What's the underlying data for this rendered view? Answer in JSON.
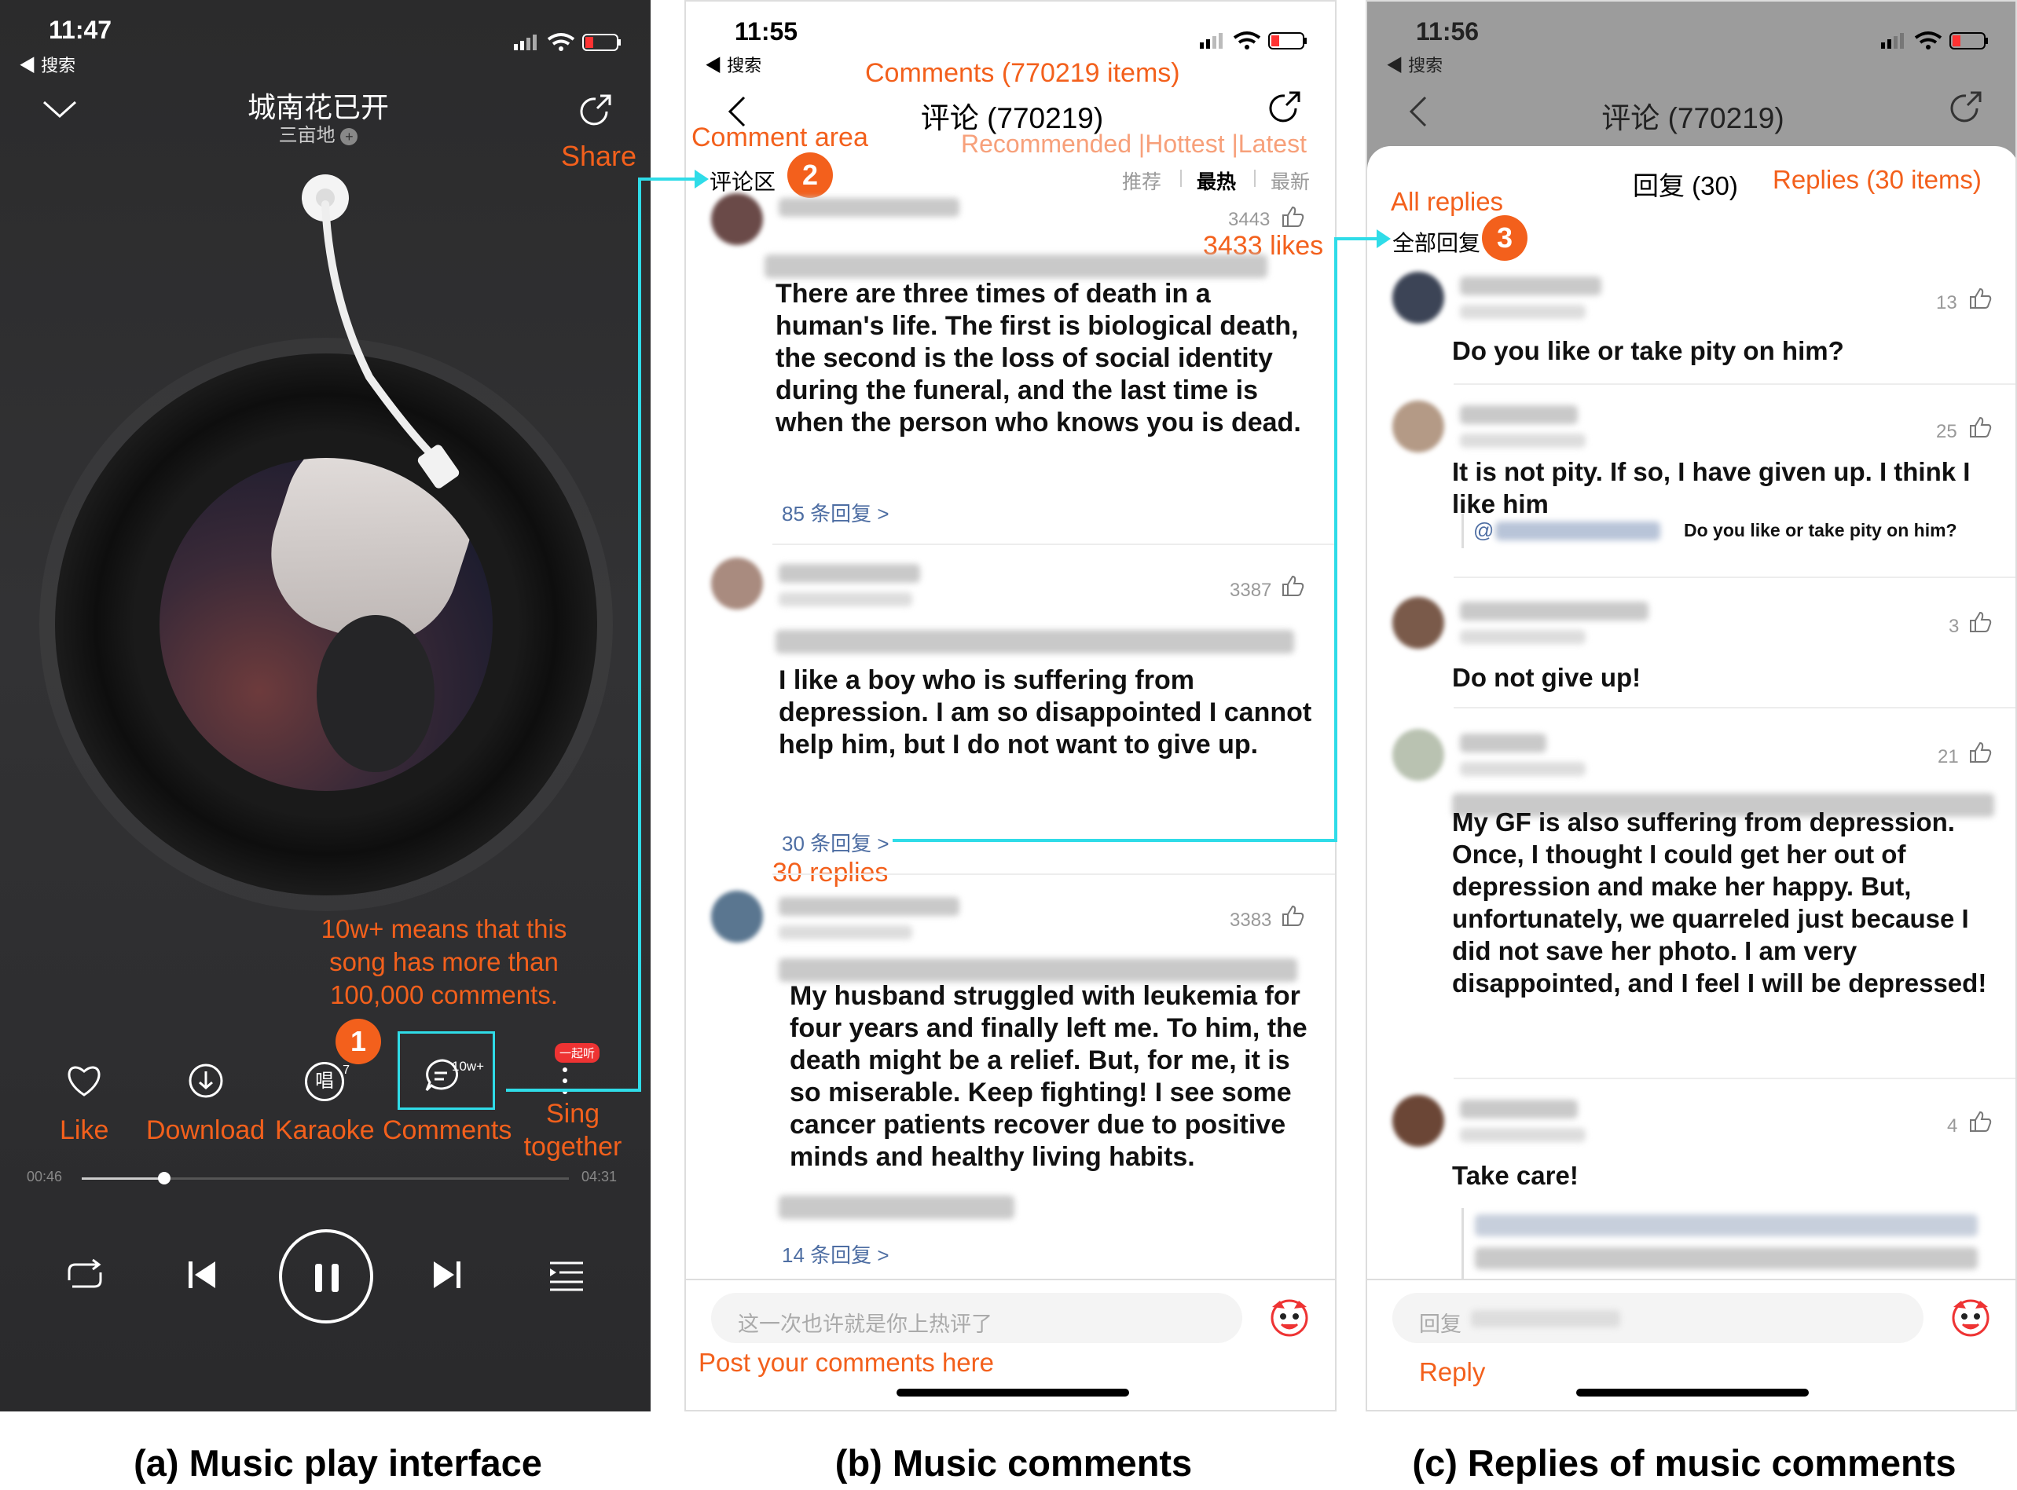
{
  "panel_a": {
    "time": "11:47",
    "back_app": "◀ 搜索",
    "song_title": "城南花已开",
    "artist": "三亩地",
    "share_label": "Share",
    "annotation_comments": "10w+ means that this song has more than 100,000 comments.",
    "comment_count_badge": "10w+",
    "sing_badge": "一起听",
    "karaoke_glyph": "唱",
    "karaoke_badge_num": "7",
    "controls": {
      "like": "Like",
      "download": "Download",
      "karaoke": "Karaoke",
      "comments": "Comments",
      "sing_together": "Sing together"
    },
    "progress": {
      "elapsed": "00:46",
      "total": "04:31",
      "fraction": 0.17
    },
    "caption": "(a) Music play interface"
  },
  "panel_b": {
    "time": "11:55",
    "back_app": "◀ 搜索",
    "annotation_title": "Comments (770219 items)",
    "title": "评论 (770219)",
    "annotation_area": "Comment area",
    "section_label": "评论区",
    "annotation_sort": "Recommended |Hottest |Latest",
    "sort_tabs": [
      "推荐",
      "最热",
      "最新"
    ],
    "active_sort": "最热",
    "annotation_likes": "3433 likes",
    "comments": [
      {
        "likes": "3443",
        "text": "There are three times of death in a human's life. The first is biological death, the second is the loss of social identity during the funeral, and the last time is when the person who knows you is dead.",
        "replies": "85 条回复 >"
      },
      {
        "likes": "3387",
        "text": "I like a boy who is suffering from depression. I am so disappointed I cannot help him, but I do not want to give up.",
        "replies": "30 条回复 >"
      },
      {
        "likes": "3383",
        "text": "My husband struggled with leukemia for four years and finally left me. To him, the death might be a relief. But, for me, it is so miserable. Keep fighting! I see some cancer patients recover due to positive minds and healthy living habits.",
        "replies": "14 条回复 >"
      }
    ],
    "annotation_replies": "30 replies",
    "input_placeholder": "这一次也许就是你上热评了",
    "annotation_post": "Post your comments here",
    "caption": "(b) Music comments"
  },
  "panel_c": {
    "time": "11:56",
    "back_app": "◀ 搜索",
    "title": "评论 (770219)",
    "sheet_title": "回复 (30)",
    "annotation_sheet": "Replies (30 items)",
    "annotation_all": "All replies",
    "all_label": "全部回复",
    "replies": [
      {
        "likes": "13",
        "text": "Do you like or take pity on him?"
      },
      {
        "likes": "25",
        "text": "It is not pity. If so, I have given up. I think I like him",
        "quote": "Do you like or take pity on him?"
      },
      {
        "likes": "3",
        "text": "Do not give up!"
      },
      {
        "likes": "21",
        "text": "My GF is also suffering from depression. Once, I thought I could get her out of depression and make her happy. But, unfortunately, we quarreled just because I did not save her photo. I am very disappointed, and I feel I will be depressed!"
      },
      {
        "likes": "4",
        "text": "Take care!"
      }
    ],
    "input_label": "回复",
    "annotation_reply": "Reply",
    "caption": "(c) Replies of music comments"
  },
  "badges": [
    "1",
    "2",
    "3"
  ],
  "colors": {
    "annotation": "#f3601c",
    "connector": "#2fdce8",
    "player_bg": "#2a2a2c"
  }
}
